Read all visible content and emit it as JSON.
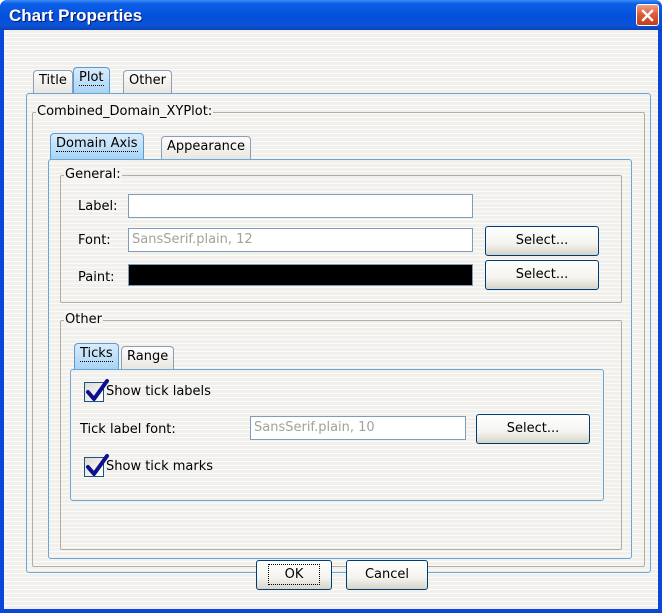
{
  "window": {
    "title": "Chart Properties",
    "close_icon": "close-icon"
  },
  "top_tabs": [
    {
      "label": "Title",
      "selected": false
    },
    {
      "label": "Plot",
      "selected": true
    },
    {
      "label": "Other",
      "selected": false
    }
  ],
  "plot": {
    "group_title": "Combined_Domain_XYPlot:",
    "axis_tabs": [
      {
        "label": "Domain Axis",
        "selected": true
      },
      {
        "label": "Appearance",
        "selected": false
      }
    ],
    "general": {
      "legend": "General:",
      "label_caption": "Label:",
      "label_value": "",
      "font_caption": "Font:",
      "font_value": "SansSerif.plain, 12",
      "font_select": "Select...",
      "paint_caption": "Paint:",
      "paint_color": "#000000",
      "paint_select": "Select..."
    },
    "other": {
      "legend": "Other",
      "tabs": [
        {
          "label": "Ticks",
          "selected": true
        },
        {
          "label": "Range",
          "selected": false
        }
      ],
      "ticks": {
        "show_tick_labels": "Show tick labels",
        "show_tick_labels_checked": true,
        "tick_label_font_caption": "Tick label font:",
        "tick_label_font_value": "SansSerif.plain, 10",
        "tick_label_font_select": "Select...",
        "show_tick_marks": "Show tick marks",
        "show_tick_marks_checked": true
      }
    }
  },
  "footer": {
    "ok": "OK",
    "cancel": "Cancel"
  },
  "colors": {
    "title_bar": "#0450dc",
    "close_button": "#df5b3a",
    "selected_tab": "#a9d4f4",
    "check_mark": "#21a121"
  }
}
